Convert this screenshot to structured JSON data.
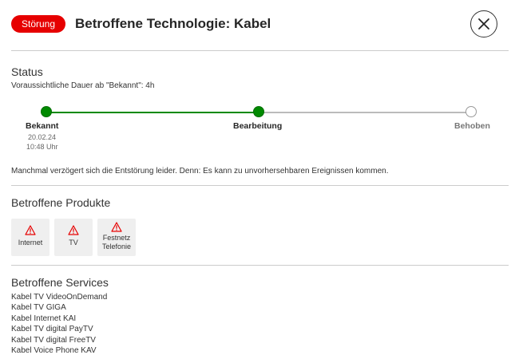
{
  "header": {
    "badge": "Störung",
    "title": "Betroffene Technologie: Kabel",
    "close_icon": "close-icon"
  },
  "status": {
    "heading": "Status",
    "duration": "Voraussichtliche Dauer ab \"Bekannt\":  4h",
    "progress": {
      "steps": [
        {
          "label": "Bekannt",
          "date": "20.02.24",
          "time": "10:48 Uhr",
          "state": "done"
        },
        {
          "label": "Bearbeitung",
          "state": "done"
        },
        {
          "label": "Behoben",
          "state": "pending"
        }
      ],
      "completed_color": "#008a00",
      "pending_color": "#bbbbbb"
    },
    "note": "Manchmal verzögert sich die Entstörung leider. Denn: Es kann zu unvorhersehbaren Ereignissen kommen."
  },
  "products": {
    "heading": "Betroffene Produkte",
    "items": [
      {
        "line1": "Internet",
        "icon": "warning-icon"
      },
      {
        "line1": "TV",
        "icon": "warning-icon"
      },
      {
        "line1": "Festnetz",
        "line2": "Telefonie",
        "icon": "warning-icon"
      }
    ]
  },
  "services": {
    "heading": "Betroffene Services",
    "items": [
      "Kabel TV VideoOnDemand",
      "Kabel TV GIGA",
      "Kabel Internet KAI",
      "Kabel TV digital PayTV",
      "Kabel TV digital FreeTV",
      "Kabel Voice Phone KAV"
    ]
  },
  "colors": {
    "brand_red": "#e60000",
    "success_green": "#008a00"
  }
}
